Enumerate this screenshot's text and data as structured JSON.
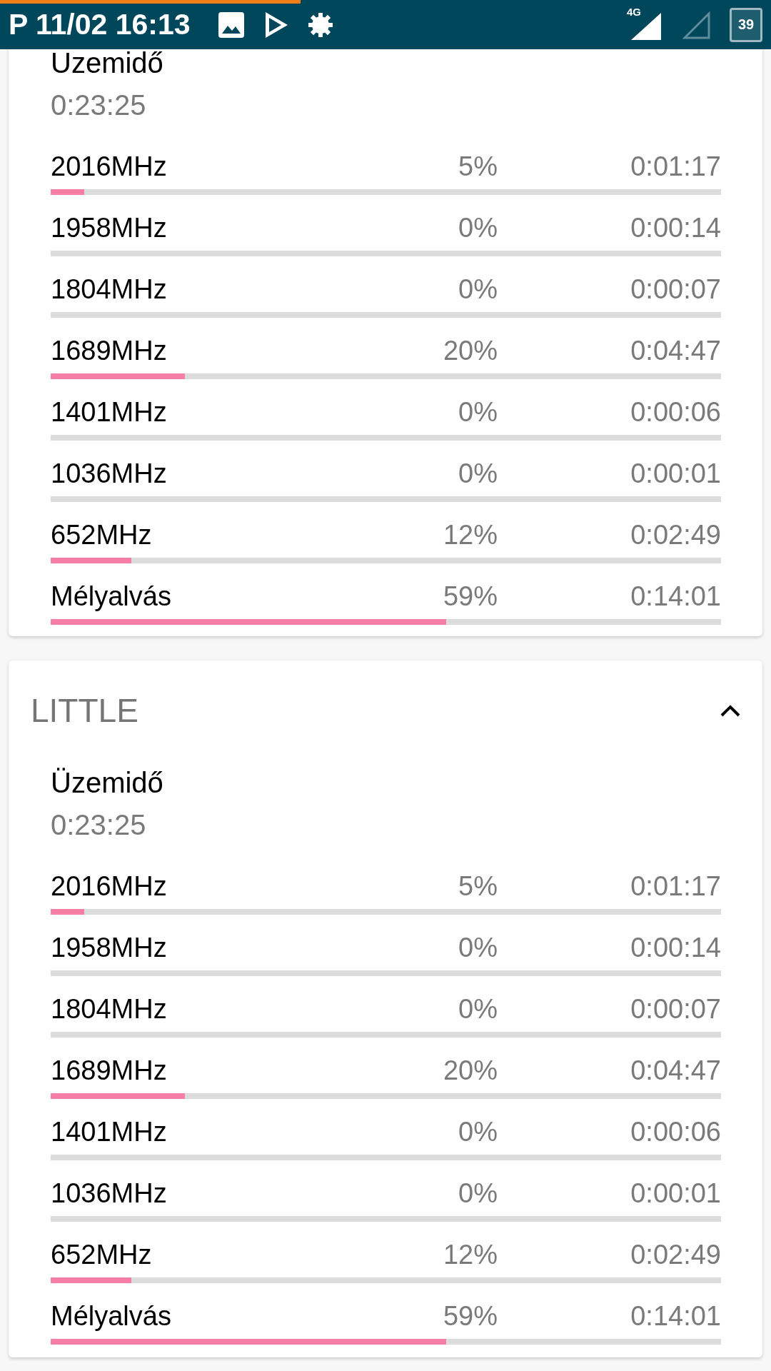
{
  "status_bar": {
    "loading": {
      "level": 0.39
    },
    "time": "P 11/02 16:13",
    "network": "4G",
    "battery": "39"
  },
  "cards": [
    {
      "runtime_label": "Uzemidő",
      "runtime_value": "0:23:25",
      "rows": [
        {
          "name": "2016MHz",
          "percent": "5%",
          "time": "0:01:17",
          "level": 0.05
        },
        {
          "name": "1958MHz",
          "percent": "0%",
          "time": "0:00:14"
        },
        {
          "name": "1804MHz",
          "percent": "0%",
          "time": "0:00:07"
        },
        {
          "name": "1689MHz",
          "percent": "20%",
          "time": "0:04:47",
          "level": 0.2
        },
        {
          "name": "1401MHz",
          "percent": "0%",
          "time": "0:00:06"
        },
        {
          "name": "1036MHz",
          "percent": "0%",
          "time": "0:00:01"
        },
        {
          "name": "652MHz",
          "percent": "12%",
          "time": "0:02:49",
          "level": 0.12
        },
        {
          "name": "Mélyalvás",
          "percent": "59%",
          "time": "0:14:01",
          "level": 0.59
        }
      ]
    },
    {
      "title": "LITTLE",
      "expanded": true,
      "runtime_label": "Üzemidő",
      "runtime_value": "0:23:25",
      "rows": [
        {
          "name": "2016MHz",
          "percent": "5%",
          "time": "0:01:17",
          "level": 0.05
        },
        {
          "name": "1958MHz",
          "percent": "0%",
          "time": "0:00:14"
        },
        {
          "name": "1804MHz",
          "percent": "0%",
          "time": "0:00:07"
        },
        {
          "name": "1689MHz",
          "percent": "20%",
          "time": "0:04:47",
          "level": 0.2
        },
        {
          "name": "1401MHz",
          "percent": "0%",
          "time": "0:00:06"
        },
        {
          "name": "1036MHz",
          "percent": "0%",
          "time": "0:00:01"
        },
        {
          "name": "652MHz",
          "percent": "12%",
          "time": "0:02:49",
          "level": 0.12
        },
        {
          "name": "Mélyalvás",
          "percent": "59%",
          "time": "0:14:01",
          "level": 0.59
        }
      ]
    }
  ]
}
